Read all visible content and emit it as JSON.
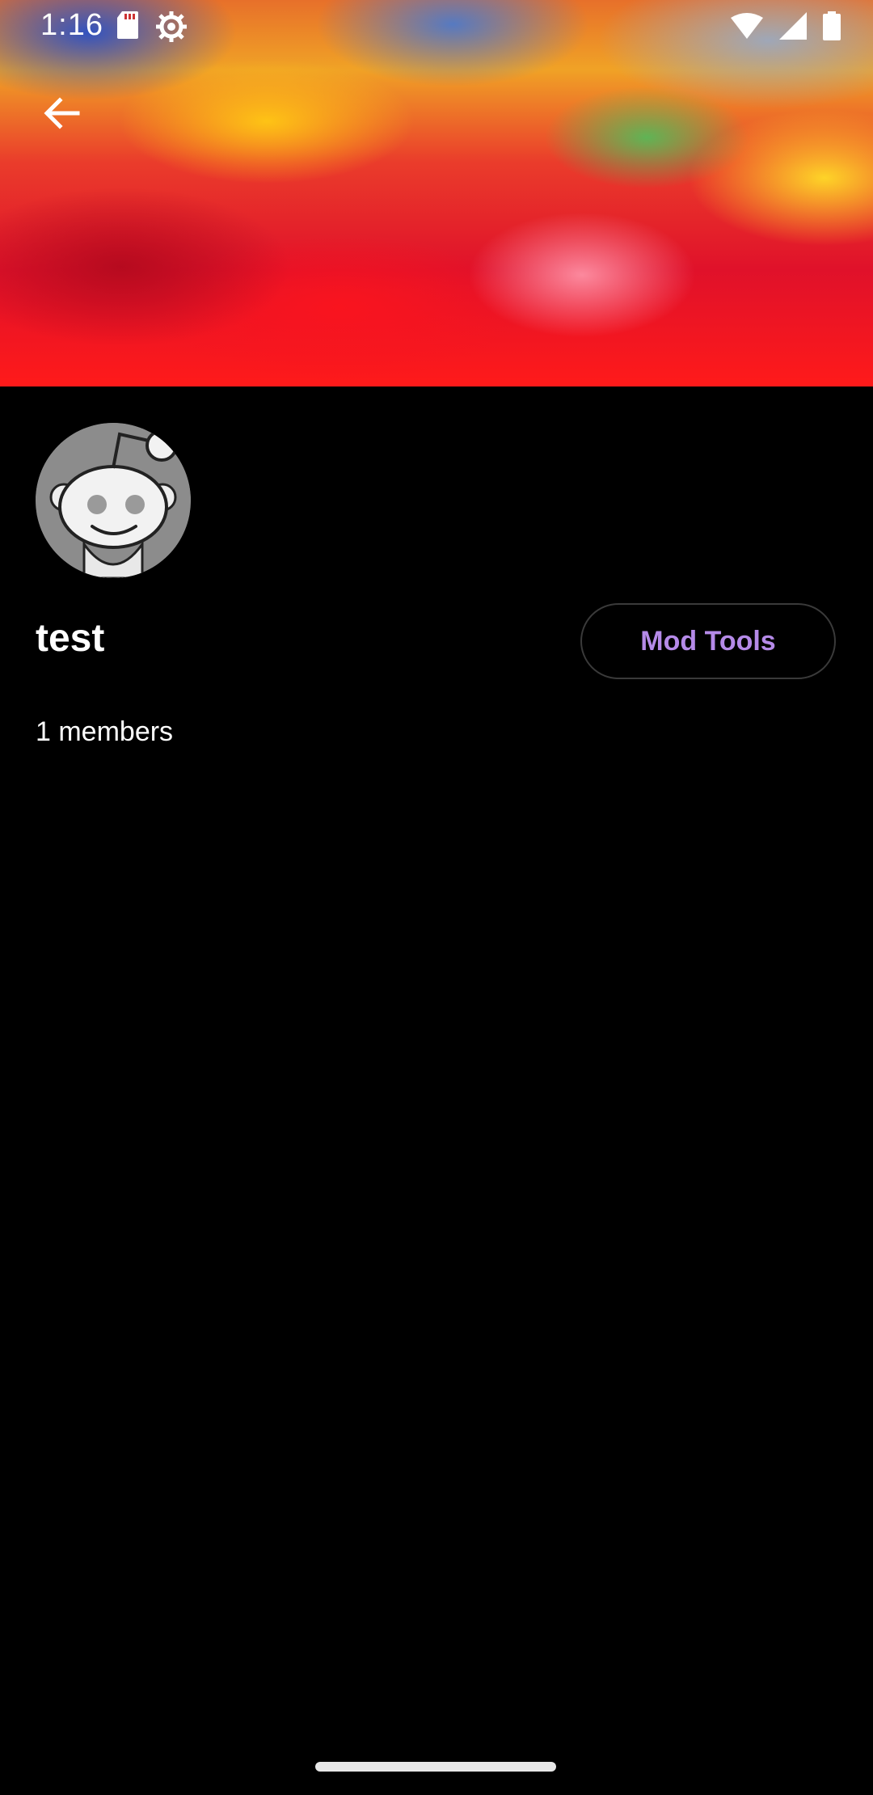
{
  "status_bar": {
    "time": "1:16",
    "icons": [
      "sd-card-icon",
      "settings-icon",
      "wifi-icon",
      "signal-icon",
      "battery-icon"
    ]
  },
  "header": {
    "back_icon": "arrow-back-icon"
  },
  "community": {
    "name": "test",
    "members_text": "1 members",
    "avatar_icon": "reddit-snoo-icon"
  },
  "actions": {
    "mod_tools_label": "Mod Tools"
  },
  "colors": {
    "background": "#000000",
    "accent": "#b58ae8",
    "button_border": "#3a3a3a"
  }
}
